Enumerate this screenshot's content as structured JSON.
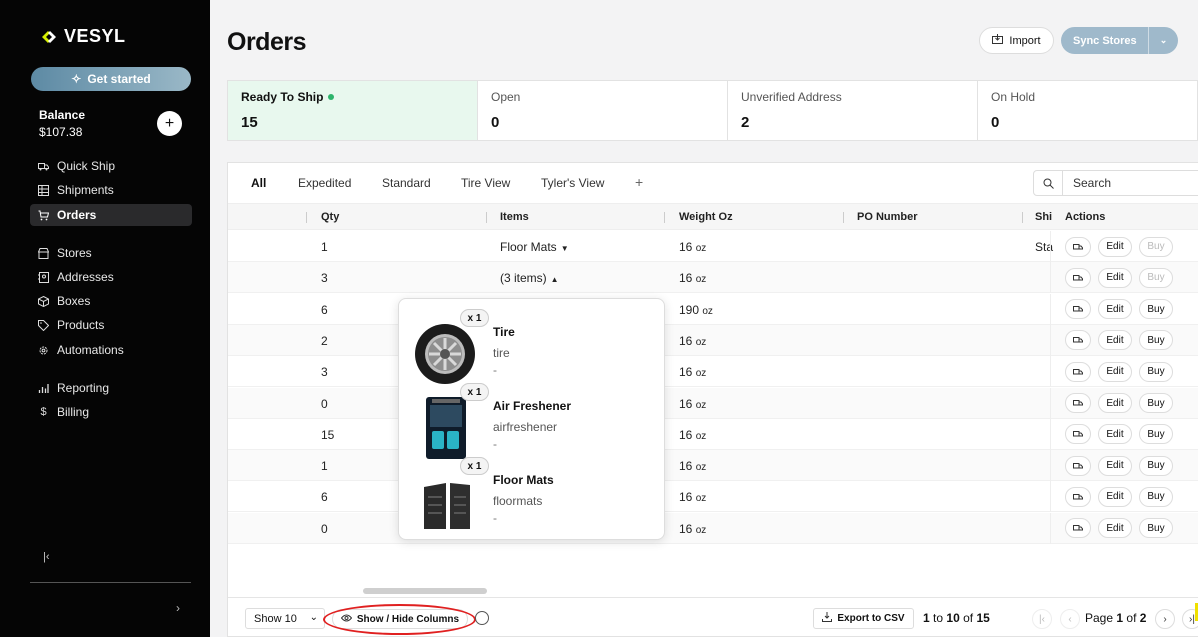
{
  "brand": {
    "name": "VESYL"
  },
  "sidebar": {
    "get_started": "Get started",
    "balance_label": "Balance",
    "balance_value": "$107.38",
    "add_label": "+",
    "collapse_label": "|‹",
    "items": [
      {
        "label": "Quick Ship",
        "icon": "truck-icon"
      },
      {
        "label": "Shipments",
        "icon": "grid-icon"
      },
      {
        "label": "Orders",
        "icon": "cart-icon",
        "active": true
      },
      {
        "label": "Stores",
        "icon": "store-icon"
      },
      {
        "label": "Addresses",
        "icon": "address-book-icon"
      },
      {
        "label": "Boxes",
        "icon": "box-icon"
      },
      {
        "label": "Products",
        "icon": "tag-icon"
      },
      {
        "label": "Automations",
        "icon": "gear-icon"
      },
      {
        "label": "Reporting",
        "icon": "bar-chart-icon"
      },
      {
        "label": "Billing",
        "icon": "dollar-icon"
      }
    ]
  },
  "header": {
    "title": "Orders",
    "import_label": "Import",
    "sync_label": "Sync Stores"
  },
  "status_cards": [
    {
      "label": "Ready To Ship",
      "count": "15",
      "active": true
    },
    {
      "label": "Open",
      "count": "0"
    },
    {
      "label": "Unverified Address",
      "count": "2"
    },
    {
      "label": "On Hold",
      "count": "0"
    }
  ],
  "tabs": [
    "All",
    "Expedited",
    "Standard",
    "Tire View",
    "Tyler's View",
    "+"
  ],
  "search": {
    "placeholder": "Search"
  },
  "columns": {
    "qty": "Qty",
    "items": "Items",
    "weight": "Weight Oz",
    "po": "PO Number",
    "ship": "Shi",
    "actions": "Actions"
  },
  "rows": [
    {
      "qty": "1",
      "items": "Floor Mats",
      "items_caret": "▼",
      "weight": "16",
      "ship": "Sta",
      "buy_disabled": true
    },
    {
      "qty": "3",
      "items": "(3 items)",
      "items_caret": "▲",
      "weight": "16",
      "ship": "",
      "buy_disabled": true
    },
    {
      "qty": "6",
      "items": "",
      "weight": "190",
      "ship": ""
    },
    {
      "qty": "2",
      "items": "",
      "weight": "16",
      "ship": ""
    },
    {
      "qty": "3",
      "items": "",
      "weight": "16",
      "ship": ""
    },
    {
      "qty": "0",
      "items": "",
      "weight": "16",
      "ship": ""
    },
    {
      "qty": "15",
      "items": "",
      "weight": "16",
      "ship": ""
    },
    {
      "qty": "1",
      "items": "",
      "weight": "16",
      "ship": ""
    },
    {
      "qty": "6",
      "items": "",
      "weight": "16",
      "ship": ""
    },
    {
      "qty": "0",
      "items": "",
      "weight": "16",
      "ship": ""
    }
  ],
  "unit_oz": "oz",
  "action_labels": {
    "edit": "Edit",
    "buy": "Buy"
  },
  "popover": [
    {
      "qty": "x 1",
      "name": "Tire",
      "sku": "tire",
      "note": "-",
      "image": "tire-image"
    },
    {
      "qty": "x 1",
      "name": "Air Freshener",
      "sku": "airfreshener",
      "note": "-",
      "image": "air-freshener-image"
    },
    {
      "qty": "x 1",
      "name": "Floor Mats",
      "sku": "floormats",
      "note": "-",
      "image": "floor-mats-image"
    }
  ],
  "footer": {
    "show_select": "Show 10",
    "show_hide": "Show / Hide Columns",
    "export": "Export to CSV",
    "range_from": "1",
    "range_to": "10",
    "range_total": "15",
    "range_to_word": "to",
    "range_of_word": "of",
    "page_word": "Page",
    "page_current": "1",
    "page_of_word": "of",
    "page_total": "2"
  },
  "colors": {
    "accent_green": "#2db46b",
    "active_card_bg": "#e8f8ee",
    "sync_button": "#9fb9cb",
    "annotation_red": "#e02020",
    "brand_yellow": "#d7f000"
  }
}
